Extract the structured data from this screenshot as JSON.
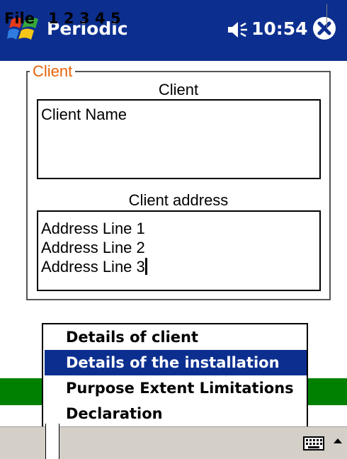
{
  "titlebar": {
    "title": "Periodic",
    "time": "10:54"
  },
  "client_group": {
    "legend": "Client",
    "client_caption": "Client",
    "client_value": "Client Name",
    "address_caption": "Client address",
    "address_value": "Address Line 1\nAddress Line 2\nAddress Line 3"
  },
  "popup_menu": {
    "items": [
      {
        "label": "Details of client"
      },
      {
        "label": "Details of the installation",
        "selected": true
      },
      {
        "label": "Purpose Extent Limitations"
      },
      {
        "label": "Declaration"
      }
    ]
  },
  "menubar": {
    "file": "File",
    "tabs": [
      "1",
      "2",
      "3",
      "4",
      "5"
    ],
    "active_tab": "1"
  },
  "colors": {
    "titlebar": "#0c2f8f",
    "legend": "#e8640a",
    "green_band": "#008000",
    "menubar": "#d4d0c8"
  }
}
